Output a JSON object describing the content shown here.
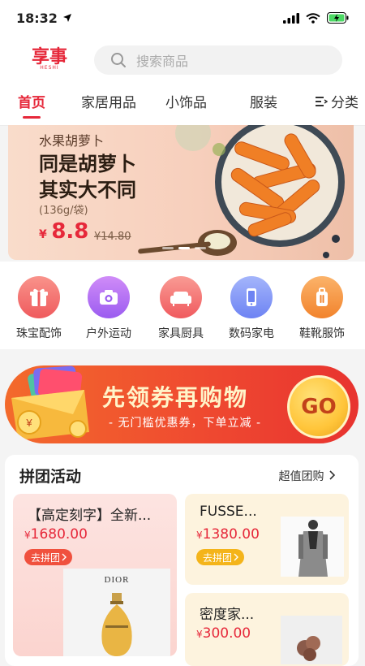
{
  "status": {
    "time": "18:32"
  },
  "header": {
    "logo_text": "享事",
    "logo_subtext": "HESHI",
    "search_placeholder": "搜索商品"
  },
  "tabs": [
    {
      "label": "首页",
      "active": true
    },
    {
      "label": "家居用品",
      "active": false
    },
    {
      "label": "小饰品",
      "active": false
    },
    {
      "label": "服装",
      "active": false
    }
  ],
  "category_tab": {
    "label": "分类"
  },
  "banner": {
    "subtitle": "水果胡萝卜",
    "title_line1": "同是胡萝卜",
    "title_line2": "其实大不同",
    "weight": "(136g/袋)",
    "currency": "¥",
    "price": "8.8",
    "old_price": "¥14.80"
  },
  "categories": [
    {
      "label": "珠宝配饰",
      "icon": "gift-icon",
      "color": "#f26b66"
    },
    {
      "label": "户外运动",
      "icon": "camera-icon",
      "color": "#b46ff2"
    },
    {
      "label": "家具厨具",
      "icon": "sofa-icon",
      "color": "#f6706f"
    },
    {
      "label": "数码家电",
      "icon": "phone-icon",
      "color": "#7c91f6"
    },
    {
      "label": "鞋靴服饰",
      "icon": "luggage-icon",
      "color": "#f6923f"
    }
  ],
  "coupon_banner": {
    "title": "先领券再购物",
    "subtitle": "- 无门槛优惠券，下单立减 -",
    "go_label": "GO"
  },
  "group_buy": {
    "title": "拼团活动",
    "more_label": "超值团购",
    "cards": [
      {
        "name": "【高定刻字】全新...",
        "currency": "¥",
        "price": "1680.00",
        "button": "去拼团",
        "button_color": "#f0513e",
        "image_brand": "DIOR"
      },
      {
        "name": "FUSSE...",
        "currency": "¥",
        "price": "1380.00",
        "button": "去拼团",
        "button_color": "#f4b41a"
      },
      {
        "name": "密度家...",
        "currency": "¥",
        "price": "300.00"
      }
    ]
  }
}
